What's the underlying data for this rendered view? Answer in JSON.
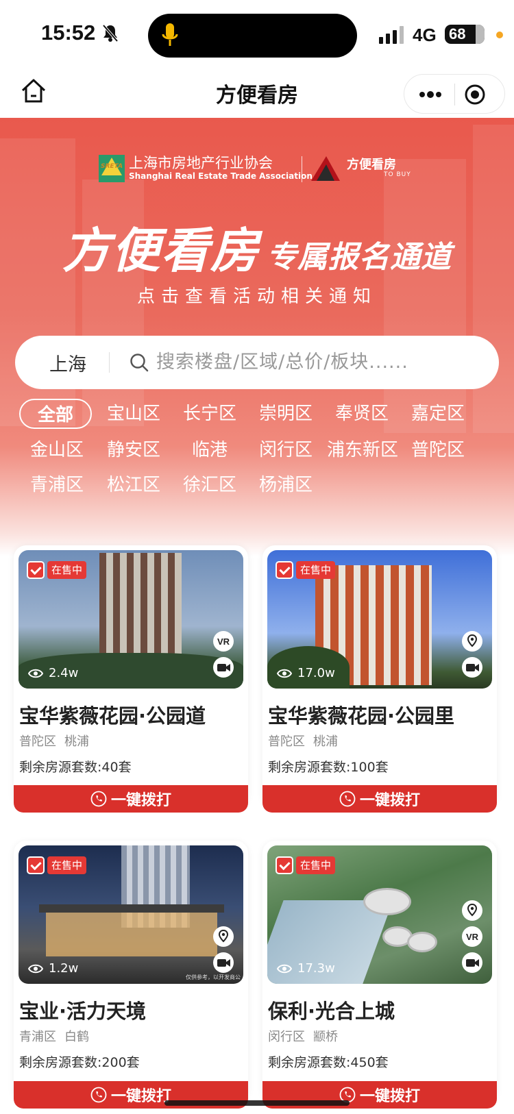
{
  "status_bar": {
    "time": "15:52",
    "network": "4G",
    "battery": "68"
  },
  "navbar": {
    "title": "方便看房"
  },
  "hero": {
    "association_cn": "上海市房地产行业协会",
    "association_en": "Shanghai Real Estate Trade Association",
    "association_logo_text": "SRETA",
    "brand_name": "方便看房",
    "brand_sub": "TO BUY",
    "title_main": "方便看房",
    "title_sub": "专属报名通道",
    "subtitle": "点击查看活动相关通知"
  },
  "search": {
    "city": "上海",
    "placeholder": "搜索楼盘/区域/总价/板块......"
  },
  "districts": [
    "全部",
    "宝山区",
    "长宁区",
    "崇明区",
    "奉贤区",
    "嘉定区",
    "金山区",
    "静安区",
    "临港",
    "闵行区",
    "浦东新区",
    "普陀区",
    "青浦区",
    "松江区",
    "徐汇区",
    "杨浦区"
  ],
  "listings": [
    {
      "status": "在售中",
      "views": "2.4w",
      "name": "宝华紫薇花园·公园道",
      "district": "普陀区",
      "area": "桃浦",
      "remaining": "剩余房源套数:40套",
      "icons": [
        "vr-icon",
        "video-icon"
      ],
      "call_label": "一键拨打"
    },
    {
      "status": "在售中",
      "views": "17.0w",
      "name": "宝华紫薇花园·公园里",
      "district": "普陀区",
      "area": "桃浦",
      "remaining": "剩余房源套数:100套",
      "icons": [
        "location-icon",
        "video-icon"
      ],
      "call_label": "一键拨打"
    },
    {
      "status": "在售中",
      "views": "1.2w",
      "name": "宝业·活力天境",
      "district": "青浦区",
      "area": "白鹤",
      "remaining": "剩余房源套数:200套",
      "icons": [
        "location-icon",
        "video-icon"
      ],
      "call_label": "一键拨打",
      "watermark": "仅供参考，以开发商公"
    },
    {
      "status": "在售中",
      "views": "17.3w",
      "name": "保利·光合上城",
      "district": "闵行区",
      "area": "颛桥",
      "remaining": "剩余房源套数:450套",
      "icons": [
        "location-icon",
        "vr-icon",
        "video-icon"
      ],
      "call_label": "一键拨打"
    }
  ],
  "colors": {
    "primary_red": "#d9302b",
    "hero_red": "#e9594d",
    "badge_red": "#e53935"
  }
}
